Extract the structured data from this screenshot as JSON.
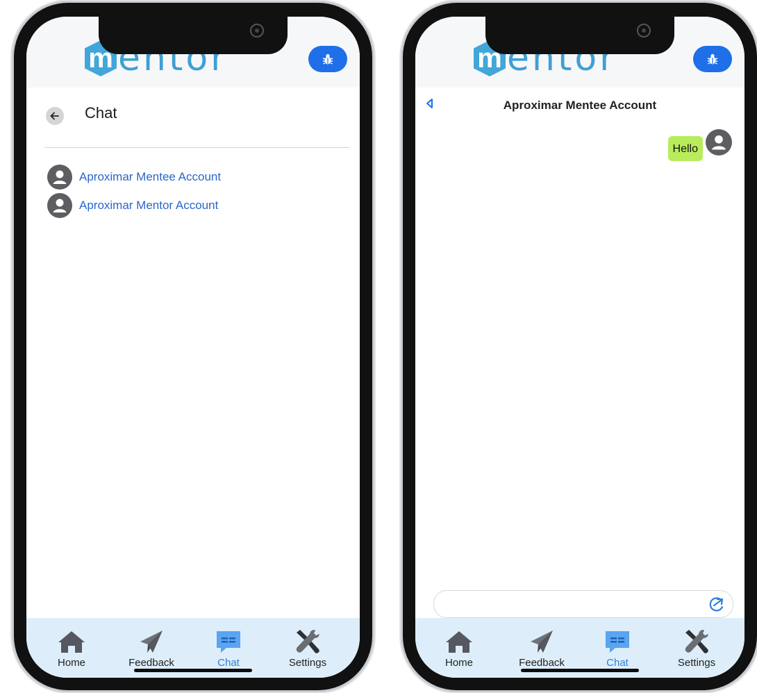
{
  "brand": {
    "logo_letter": "m",
    "logo_word": "entor",
    "logo_plus": "+"
  },
  "colors": {
    "accent": "#1e6fe8",
    "link": "#2a66c8",
    "bubble": "#b8ec5c",
    "tabbar": "#ddeefa"
  },
  "icons": {
    "bug": "bug-icon",
    "back": "arrow-left-icon",
    "avatar": "user-circle-icon",
    "send": "send-icon",
    "home": "home-icon",
    "feedback": "paper-plane-icon",
    "chat": "chat-icon",
    "settings": "tools-icon"
  },
  "chat_list": {
    "title": "Chat",
    "contacts": [
      {
        "name": "Aproximar Mentee Account"
      },
      {
        "name": "Aproximar Mentor Account"
      }
    ]
  },
  "conversation": {
    "title": "Aproximar Mentee Account",
    "messages": [
      {
        "text": "Hello",
        "from": "self"
      }
    ],
    "input_value": "",
    "input_placeholder": ""
  },
  "tabs": [
    {
      "label": "Home",
      "active": false
    },
    {
      "label": "Feedback",
      "active": false
    },
    {
      "label": "Chat",
      "active": true
    },
    {
      "label": "Settings",
      "active": false
    }
  ]
}
